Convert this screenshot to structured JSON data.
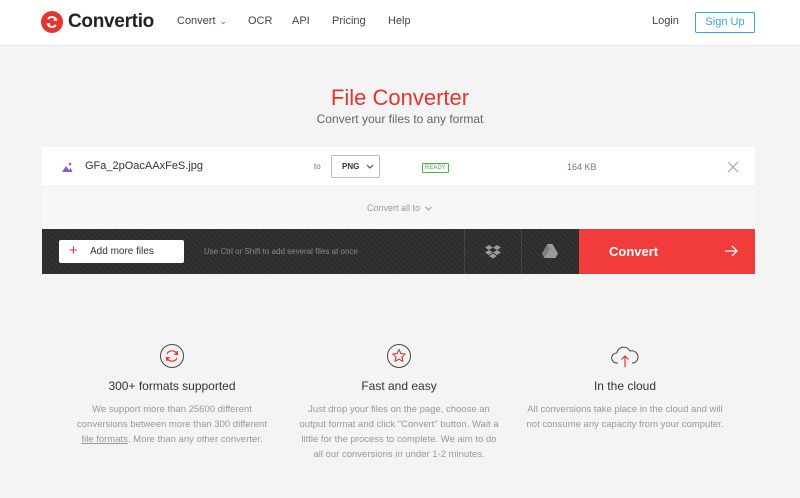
{
  "header": {
    "logo_text": "Convertio",
    "nav": [
      {
        "label": "Convert",
        "has_dropdown": true
      },
      {
        "label": "OCR"
      },
      {
        "label": "API"
      },
      {
        "label": "Pricing"
      },
      {
        "label": "Help"
      }
    ],
    "login_label": "Login",
    "signup_label": "Sign Up"
  },
  "hero": {
    "title": "File Converter",
    "subtitle": "Convert your files to any format"
  },
  "file": {
    "name": "GFa_2pOacAAxFeS.jpg",
    "to_label": "to",
    "format": "PNG",
    "status": "READY",
    "size": "164 KB",
    "file_icon": "image-file-icon",
    "remove_icon": "close-icon"
  },
  "convert_all": {
    "label": "Convert all to"
  },
  "action_bar": {
    "add_files_label": "Add more files",
    "hint": "Use Ctrl or Shift to add several files at once",
    "dropbox_icon": "dropbox-icon",
    "drive_icon": "google-drive-icon",
    "convert_label": "Convert"
  },
  "features": [
    {
      "icon": "refresh-icon",
      "title": "300+ formats supported",
      "text_before": "We support more than 25600 different conversions between more than 300 different ",
      "link": "file formats",
      "text_after": ". More than any other converter."
    },
    {
      "icon": "star-icon",
      "title": "Fast and easy",
      "text": "Just drop your files on the page, choose an output format and click \"Convert\" button. Wait a little for the process to complete. We aim to do all our conversions in under 1-2 minutes."
    },
    {
      "icon": "cloud-upload-icon",
      "title": "In the cloud",
      "text": "All conversions take place in the cloud and will not consume any capacity from your computer."
    }
  ],
  "colors": {
    "brand_red": "#e5342f",
    "convert_red": "#f23b3b",
    "signup_blue": "#3aa3e3",
    "ready_green": "#4caf50"
  }
}
